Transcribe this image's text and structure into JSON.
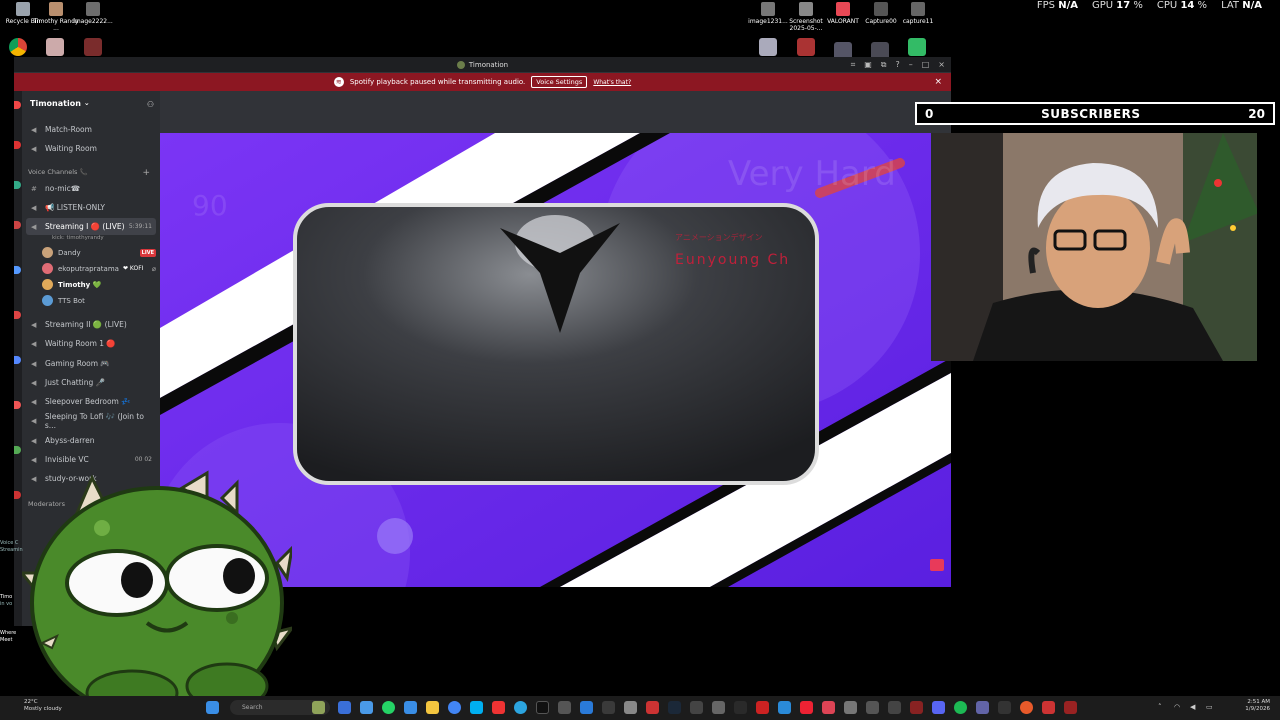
{
  "desktop": {
    "icons_left": [
      {
        "label": "Recycle Bin"
      },
      {
        "label": "Timothy Randy ..."
      },
      {
        "label": "image2222..."
      }
    ],
    "icons_right": [
      {
        "label": "image1231..."
      },
      {
        "label": "Screenshot 2025-05-..."
      },
      {
        "label": "VALORANT"
      },
      {
        "label": "Capture00"
      },
      {
        "label": "capture11"
      }
    ]
  },
  "perf": {
    "fps_label": "FPS",
    "fps_value": "N/A",
    "gpu_label": "GPU",
    "gpu_value": "17",
    "cpu_label": "CPU",
    "cpu_value": "14",
    "lat_label": "LAT",
    "lat_value": "N/A",
    "percent_sign": "%"
  },
  "discord": {
    "window_title": "Timonation",
    "notice": {
      "text": "Spotify playback paused while transmitting audio.",
      "button": "Voice Settings",
      "link": "What's that?"
    },
    "server_name": "Timonation",
    "top_channels": [
      {
        "name": "Match-Room"
      },
      {
        "name": "Waiting Room"
      }
    ],
    "category_voice": "Voice Channels 📞",
    "channels": [
      {
        "name": "no-mic☎",
        "type": "text"
      },
      {
        "name": "📢 LISTEN-ONLY",
        "type": "voice"
      },
      {
        "name": "Streaming I 🔴 (LIVE)",
        "type": "voice",
        "time": "5:39:11",
        "sub": "kick: timothyrandy"
      },
      {
        "name": "Streaming II 🟢 (LIVE)",
        "type": "voice"
      },
      {
        "name": "Waiting Room 1 🔴",
        "type": "voice"
      },
      {
        "name": "Gaming Room 🎮",
        "type": "voice"
      },
      {
        "name": "Just Chatting 🎤",
        "type": "voice"
      },
      {
        "name": "Sleepover Bedroom 💤",
        "type": "voice"
      },
      {
        "name": "Sleeping To Lofi 🎶 (Join to s...",
        "type": "voice"
      },
      {
        "name": "Abyss-darren",
        "type": "voice"
      },
      {
        "name": "Invisible VC",
        "type": "voice",
        "time": "00 02"
      },
      {
        "name": "study-or-work",
        "type": "voice"
      }
    ],
    "members": [
      {
        "name": "Dandy",
        "badge": "LIVE",
        "color": "#c9a27a"
      },
      {
        "name": "ekoputrapratama",
        "tag": "❤ KOFI",
        "color": "#e06c75"
      },
      {
        "name": "Timothy 💚",
        "color": "#e0a95a"
      },
      {
        "name": "TTS Bot",
        "color": "#5b9bd5"
      }
    ],
    "category_mod": "Moderators"
  },
  "overlay": {
    "subs_current": "0",
    "subs_label": "SUBSCRIBERS",
    "subs_goal": "20"
  },
  "stream": {
    "bg_text_top": "Very Hard",
    "bg_text_left": "90",
    "card_caption_jp": "アニメーションデザイン",
    "card_caption": "Eunyoung Ch"
  },
  "edge_chat": {
    "line1": "Voice C",
    "line2": "Streamin",
    "line3": "Timo",
    "line4": "in vo",
    "line5": "Where",
    "line6": "Meet"
  },
  "taskbar": {
    "temp": "22°C",
    "weather": "Mostly cloudy",
    "search": "Search",
    "time": "2:51 AM",
    "date": "1/9/2026"
  },
  "colors": {
    "discord_bg": "#313338",
    "sidebar_bg": "#2b2d31",
    "notice_bg": "#8c1722",
    "stream_purple": "#6e2ef5",
    "mascot_green": "#4a8a2a"
  }
}
